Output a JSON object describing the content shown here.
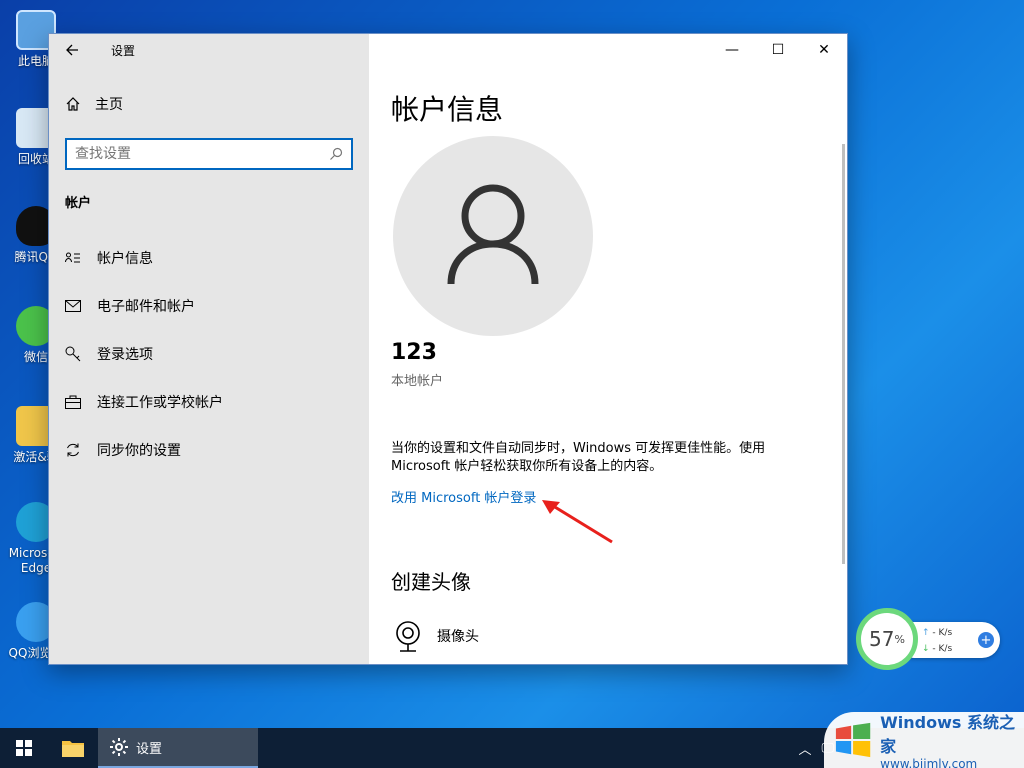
{
  "desktop": {
    "icons": [
      {
        "label": "此电脑"
      },
      {
        "label": "回收站"
      },
      {
        "label": "腾讯QQ"
      },
      {
        "label": "微信"
      },
      {
        "label": "激活&驱"
      },
      {
        "label": "Microsoft Edge"
      },
      {
        "label": "QQ浏览器"
      }
    ]
  },
  "window": {
    "title": "设置",
    "controls": {
      "minimize": "—",
      "maximize": "☐",
      "close": "✕"
    }
  },
  "sidebar": {
    "home_label": "主页",
    "search_placeholder": "查找设置",
    "section_label": "帐户",
    "items": [
      {
        "label": "帐户信息",
        "icon": "account-info-icon"
      },
      {
        "label": "电子邮件和帐户",
        "icon": "mail-icon"
      },
      {
        "label": "登录选项",
        "icon": "key-icon"
      },
      {
        "label": "连接工作或学校帐户",
        "icon": "briefcase-icon"
      },
      {
        "label": "同步你的设置",
        "icon": "sync-icon"
      }
    ]
  },
  "main": {
    "title": "帐户信息",
    "username": "123",
    "account_type": "本地帐户",
    "description": "当你的设置和文件自动同步时，Windows 可发挥更佳性能。使用 Microsoft 帐户轻松获取你所有设备上的内容。",
    "ms_link": "改用 Microsoft 帐户登录",
    "avatar_section_title": "创建头像",
    "camera_label": "摄像头"
  },
  "widget": {
    "percent": "57",
    "percent_unit": "%",
    "upload": "- K/s",
    "download": "- K/s"
  },
  "taskbar": {
    "settings_label": "设置"
  },
  "watermark": {
    "brand": "Windows",
    "brand_suffix": "系统之家",
    "url": "www.bjjmlv.com"
  },
  "colors": {
    "accent": "#0067c0",
    "sidebar_bg": "#e6e6e6",
    "taskbar_bg": "#0d1f36"
  }
}
